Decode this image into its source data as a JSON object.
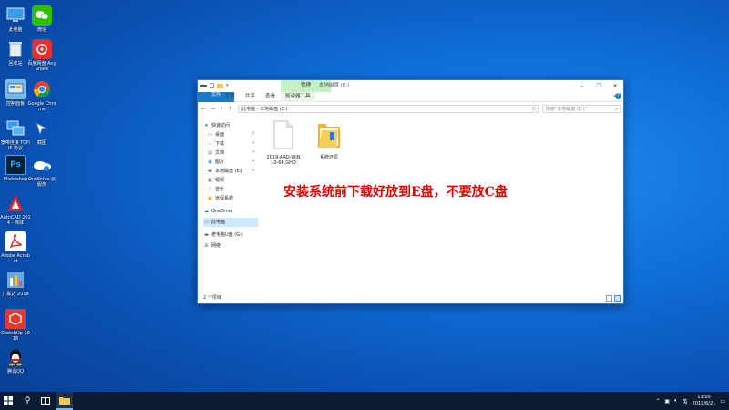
{
  "desktop": {
    "icons": [
      {
        "label": "此电脑",
        "icon": "computer-icon"
      },
      {
        "label": "微信",
        "icon": "wechat-icon"
      },
      {
        "label": "回收站",
        "icon": "recycle-bin-icon"
      },
      {
        "label": "百度网盘 AnyShare",
        "icon": "anyshare-icon"
      },
      {
        "label": "控制面板",
        "icon": "control-panel-icon"
      },
      {
        "label": "Google Chrome",
        "icon": "chrome-icon"
      },
      {
        "label": "宽带连接 TCP/IP 协议",
        "icon": "network-icon"
      },
      {
        "label": "截图",
        "icon": "snip-icon"
      },
      {
        "label": "Photoshop",
        "icon": "photoshop-icon"
      },
      {
        "label": "OneDrive 云服务",
        "icon": "onedrive-icon"
      },
      {
        "label": "AutoCAD 2014 - 简体",
        "icon": "autocad-icon"
      },
      {
        "label": "Adobe Acrobat",
        "icon": "acrobat-icon"
      },
      {
        "label": "广联达 2018",
        "icon": "glodon-icon"
      },
      {
        "label": "SketchUp 2018",
        "icon": "sketchup-icon"
      },
      {
        "label": "腾讯QQ",
        "icon": "qq-icon"
      }
    ]
  },
  "window": {
    "title": "本地磁盘 (E:)",
    "context_tab": "管理",
    "ribbon_tabs": [
      "文件",
      "主页",
      "共享",
      "查看",
      "驱动器工具"
    ],
    "address": "此电脑  ›  本地磁盘 (E:)",
    "search_placeholder": "搜索\"本地磁盘 (E:)\"",
    "nav_items": [
      {
        "label": "快速访问",
        "icon": "star-icon",
        "pinned": false
      },
      {
        "label": "桌面",
        "icon": "desktop-icon",
        "pinned": true
      },
      {
        "label": "下载",
        "icon": "download-icon",
        "pinned": true
      },
      {
        "label": "文档",
        "icon": "document-icon",
        "pinned": true
      },
      {
        "label": "图片",
        "icon": "picture-icon",
        "pinned": true
      },
      {
        "label": "本地磁盘 (E:)",
        "icon": "drive-icon",
        "pinned": true
      },
      {
        "label": "视频",
        "icon": "video-icon",
        "pinned": false
      },
      {
        "label": "音乐",
        "icon": "music-icon",
        "pinned": false
      },
      {
        "label": "远程系统",
        "icon": "folder-icon",
        "pinned": false
      },
      {
        "label": "OneDrive",
        "icon": "onedrive-icon",
        "pinned": false
      },
      {
        "label": "此电脑",
        "icon": "computer-icon",
        "pinned": false
      },
      {
        "label": "老毛桃U盘 (G:)",
        "icon": "usb-drive-icon",
        "pinned": false
      },
      {
        "label": "网络",
        "icon": "network-icon",
        "pinned": false
      }
    ],
    "files": [
      {
        "name": "2019-AAD-WIN10-64.GHO",
        "icon": "file-icon"
      },
      {
        "name": "系统还原",
        "icon": "folder-icon"
      }
    ],
    "status": "2 个项目"
  },
  "overlay": {
    "text": "安装系统前下载好放到E盘，不要放C盘",
    "color": "#e00000"
  },
  "taskbar": {
    "time": "13:00",
    "date": "2019/6/21",
    "ime": "英"
  }
}
